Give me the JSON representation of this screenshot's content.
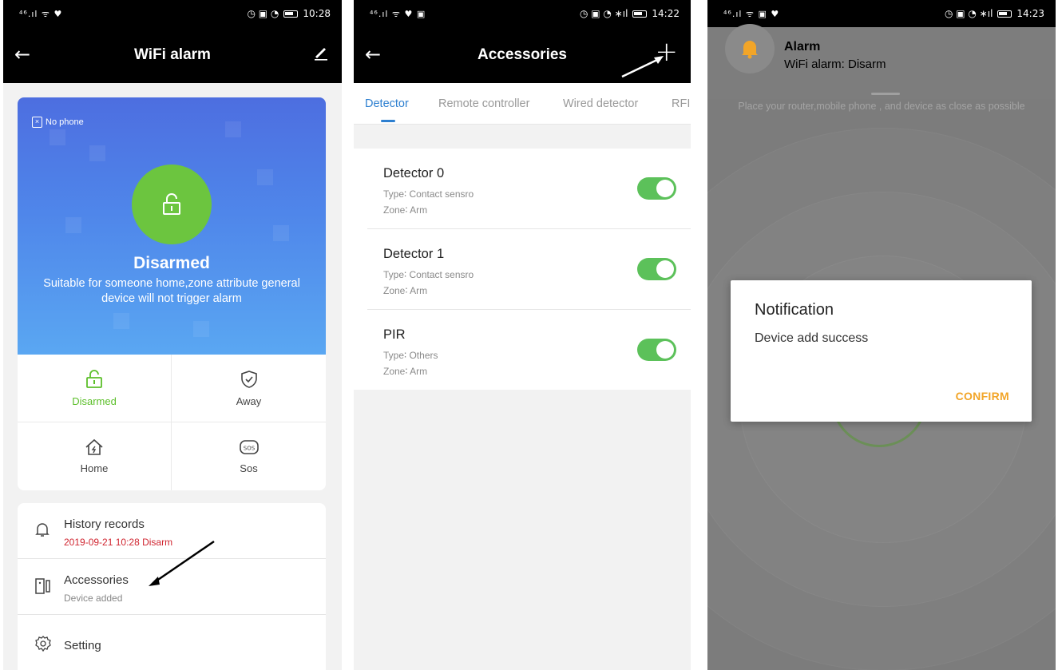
{
  "screen1": {
    "status": {
      "signal": "4G",
      "time": "10:28"
    },
    "title": "WiFi alarm",
    "hero": {
      "no_phone": "No phone",
      "status": "Disarmed",
      "description": "Suitable for someone home,zone attribute general device will not trigger alarm"
    },
    "modes": [
      {
        "label": "Disarmed",
        "icon": "unlock-icon",
        "active": true
      },
      {
        "label": "Away",
        "icon": "shield-check-icon",
        "active": false
      },
      {
        "label": "Home",
        "icon": "home-icon",
        "active": false
      },
      {
        "label": "Sos",
        "icon": "sos-icon",
        "active": false
      }
    ],
    "menu": [
      {
        "title": "History records",
        "subtitle": "2019-09-21 10:28 Disarm",
        "icon": "bell-icon"
      },
      {
        "title": "Accessories",
        "subtitle": "Device added",
        "icon": "door-sensor-icon"
      },
      {
        "title": "Setting",
        "subtitle": "",
        "icon": "gear-icon"
      }
    ]
  },
  "screen2": {
    "status": {
      "signal": "4G",
      "time": "14:22"
    },
    "title": "Accessories",
    "tabs": [
      "Detector",
      "Remote controller",
      "Wired detector",
      "RFII"
    ],
    "active_tab": "Detector",
    "detectors": [
      {
        "name": "Detector 0",
        "type": "Type∶ Contact sensro",
        "zone": "Zone∶ Arm",
        "enabled": true
      },
      {
        "name": "Detector 1",
        "type": "Type∶ Contact sensro",
        "zone": "Zone∶ Arm",
        "enabled": true
      },
      {
        "name": "PIR",
        "type": "Type∶ Others",
        "zone": "Zone∶ Arm",
        "enabled": true
      }
    ]
  },
  "screen3": {
    "status": {
      "signal": "4G",
      "time": "14:23"
    },
    "notification": {
      "title": "Alarm",
      "message": "WiFi alarm:  Disarm"
    },
    "background_hint": "Place your router,mobile phone , and device as close as possible",
    "dialog": {
      "title": "Notification",
      "message": "Device add success",
      "button": "CONFIRM"
    }
  },
  "colors": {
    "accent_green": "#5cbf2a",
    "hero_blue": "#4f86ea",
    "tab_blue": "#2d7fd0",
    "toggle_green": "#5cc15a",
    "history_red": "#d0242f",
    "confirm_orange": "#f2a528"
  }
}
